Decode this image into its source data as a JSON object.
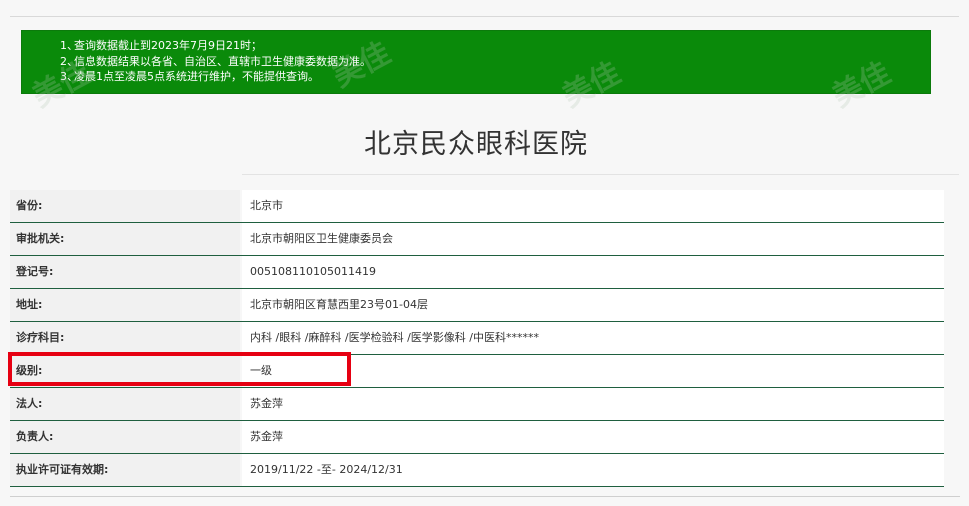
{
  "notice": {
    "lines": [
      {
        "num": "1、",
        "text": "查询数据截止到2023年7月9日21时；"
      },
      {
        "num": "2、",
        "text": "信息数据结果以各省、自治区、直辖市卫生健康委数据为准。"
      },
      {
        "num": "3、",
        "text": "凌晨1点至凌晨5点系统进行维护，不能提供查询。"
      }
    ]
  },
  "hospital": {
    "name": "北京民众眼科医院"
  },
  "details": [
    {
      "label": "省份:",
      "value": "北京市"
    },
    {
      "label": "审批机关:",
      "value": "北京市朝阳区卫生健康委员会"
    },
    {
      "label": "登记号:",
      "value": "005108110105011419"
    },
    {
      "label": "地址:",
      "value": "北京市朝阳区育慧西里23号01-04层"
    },
    {
      "label": "诊疗科目:",
      "value": "内科 /眼科 /麻醉科 /医学检验科 /医学影像科 /中医科******"
    },
    {
      "label": "级别:",
      "value": "一级"
    },
    {
      "label": "法人:",
      "value": "苏金萍"
    },
    {
      "label": "负责人:",
      "value": "苏金萍"
    },
    {
      "label": "执业许可证有效期:",
      "value": "2019/11/22 -至- 2024/12/31"
    }
  ],
  "watermark": {
    "text": "美佳"
  },
  "colors": {
    "notice_bg": "#0a8a0a",
    "row_border": "#1f5f3f",
    "highlight": "#e60012"
  }
}
